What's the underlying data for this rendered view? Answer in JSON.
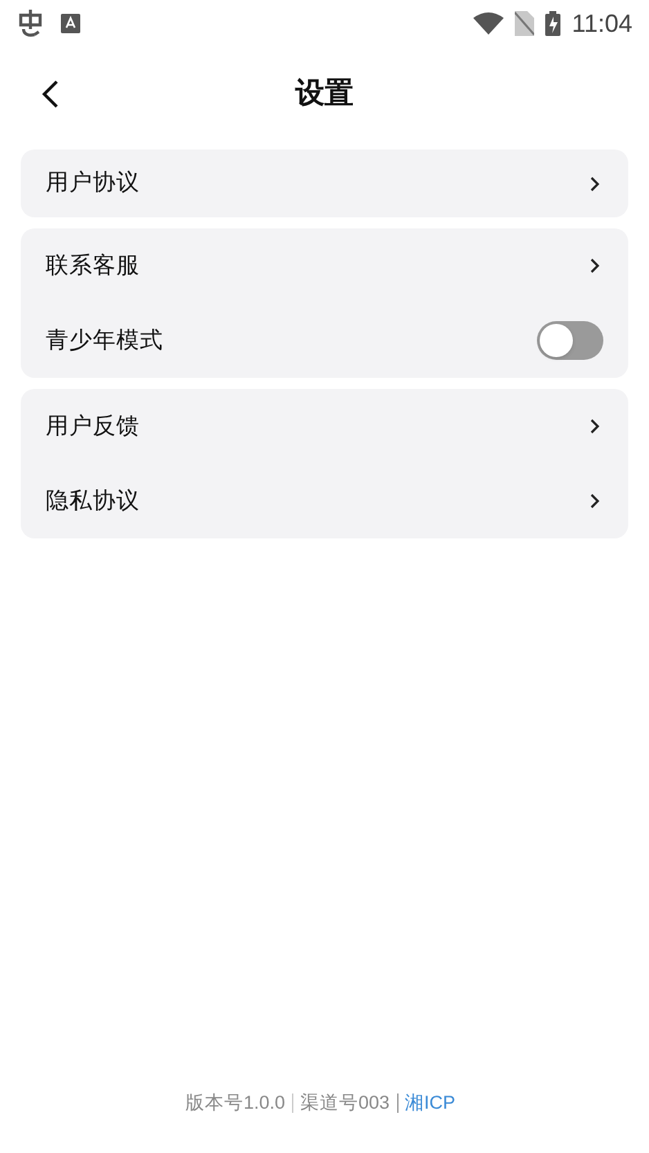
{
  "status_bar": {
    "time": "11:04"
  },
  "header": {
    "title": "设置"
  },
  "groups": [
    {
      "items": [
        {
          "kind": "link",
          "label": "用户协议"
        }
      ]
    },
    {
      "items": [
        {
          "kind": "link",
          "label": "联系客服"
        },
        {
          "kind": "toggle",
          "label": "青少年模式",
          "on": false
        }
      ]
    },
    {
      "items": [
        {
          "kind": "link",
          "label": "用户反馈"
        },
        {
          "kind": "link",
          "label": "隐私协议"
        }
      ]
    }
  ],
  "footer": {
    "version": "版本号1.0.0",
    "channel": "渠道号003",
    "icp": "湘ICP"
  }
}
